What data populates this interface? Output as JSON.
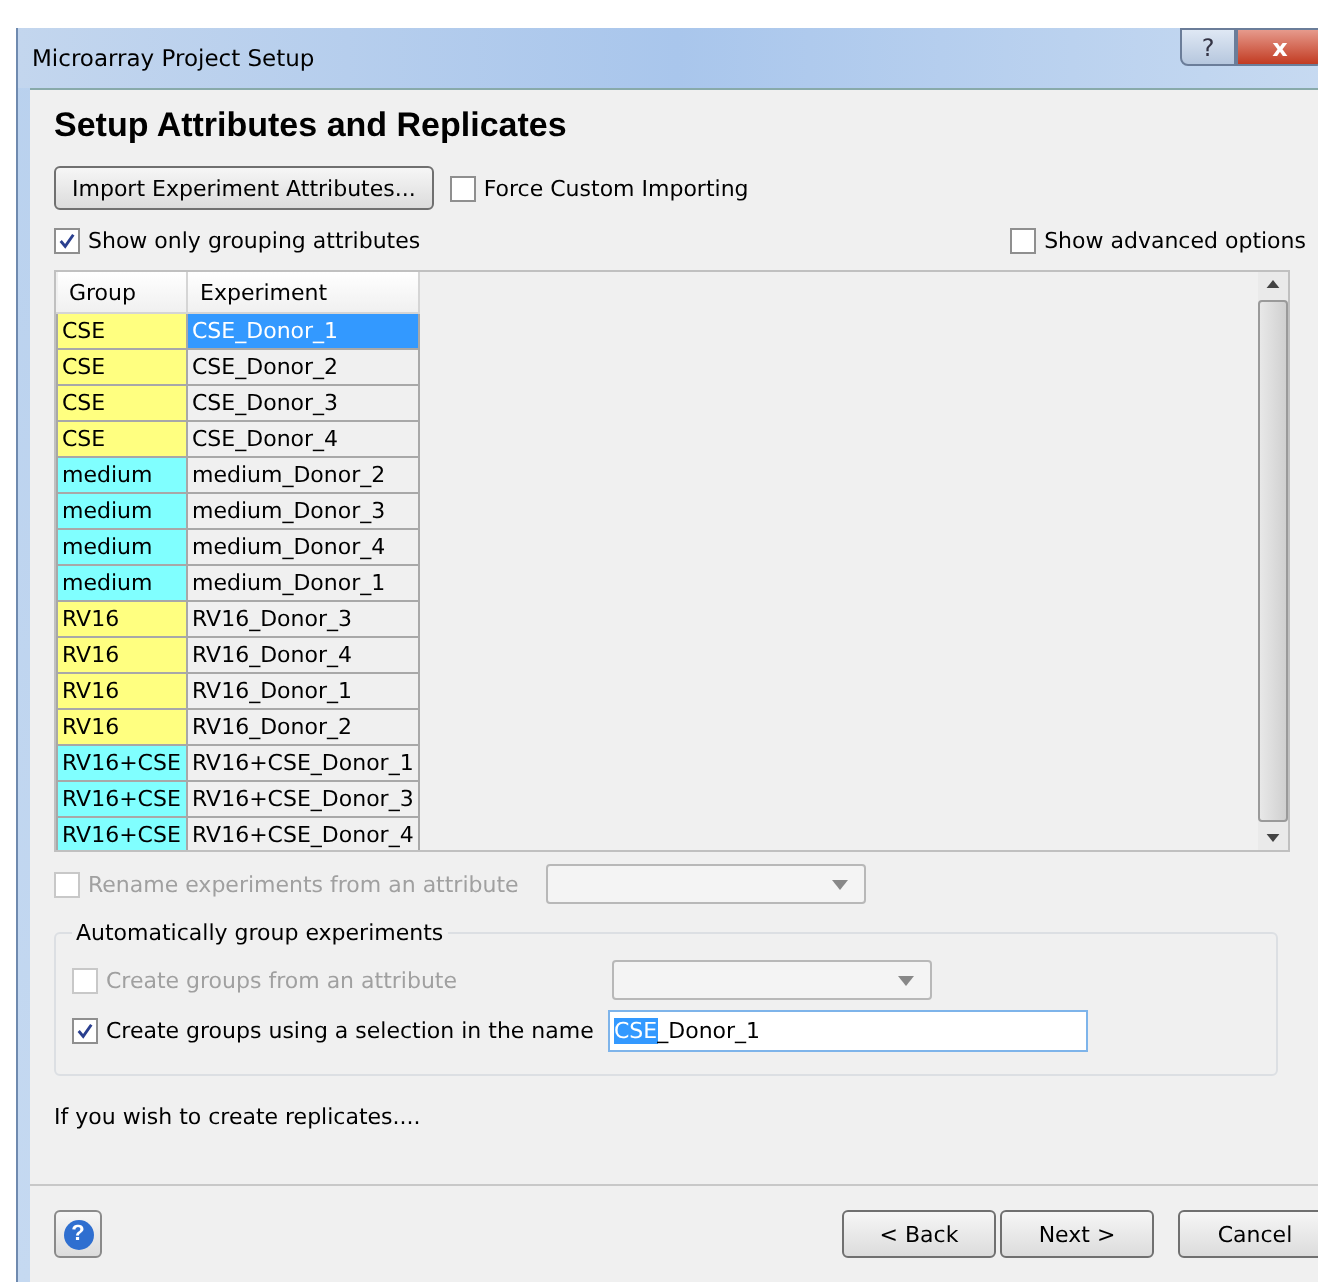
{
  "window": {
    "title": "Microarray Project Setup",
    "buttons": [
      "?",
      "x"
    ]
  },
  "heading": "Setup Attributes and Replicates",
  "import_button": "Import Experiment Attributes...",
  "force_custom_importing": {
    "label": "Force Custom Importing",
    "checked": false
  },
  "show_only_grouping": {
    "label": "Show only grouping attributes",
    "checked": true
  },
  "show_advanced": {
    "label": "Show advanced options",
    "checked": false
  },
  "table": {
    "columns": [
      "Group",
      "Experiment"
    ],
    "rows": [
      {
        "group": "CSE",
        "experiment": "CSE_Donor_1",
        "color": "#ffff80",
        "selected": true
      },
      {
        "group": "CSE",
        "experiment": "CSE_Donor_2",
        "color": "#ffff80",
        "selected": false
      },
      {
        "group": "CSE",
        "experiment": "CSE_Donor_3",
        "color": "#ffff80",
        "selected": false
      },
      {
        "group": "CSE",
        "experiment": "CSE_Donor_4",
        "color": "#ffff80",
        "selected": false
      },
      {
        "group": "medium",
        "experiment": "medium_Donor_2",
        "color": "#80ffff",
        "selected": false
      },
      {
        "group": "medium",
        "experiment": "medium_Donor_3",
        "color": "#80ffff",
        "selected": false
      },
      {
        "group": "medium",
        "experiment": "medium_Donor_4",
        "color": "#80ffff",
        "selected": false
      },
      {
        "group": "medium",
        "experiment": "medium_Donor_1",
        "color": "#80ffff",
        "selected": false
      },
      {
        "group": "RV16",
        "experiment": "RV16_Donor_3",
        "color": "#ffff80",
        "selected": false
      },
      {
        "group": "RV16",
        "experiment": "RV16_Donor_4",
        "color": "#ffff80",
        "selected": false
      },
      {
        "group": "RV16",
        "experiment": "RV16_Donor_1",
        "color": "#ffff80",
        "selected": false
      },
      {
        "group": "RV16",
        "experiment": "RV16_Donor_2",
        "color": "#ffff80",
        "selected": false
      },
      {
        "group": "RV16+CSE",
        "experiment": "RV16+CSE_Donor_1",
        "color": "#80ffff",
        "selected": false
      },
      {
        "group": "RV16+CSE",
        "experiment": "RV16+CSE_Donor_3",
        "color": "#80ffff",
        "selected": false
      },
      {
        "group": "RV16+CSE",
        "experiment": "RV16+CSE_Donor_4",
        "color": "#80ffff",
        "selected": false
      }
    ]
  },
  "rename": {
    "label": "Rename experiments from an attribute",
    "checked": false,
    "disabled": true
  },
  "group_box": {
    "title": "Automatically group experiments",
    "from_attribute": {
      "label": "Create groups from an attribute",
      "checked": false,
      "disabled": true
    },
    "using_selection": {
      "label": "Create groups using a selection in the name",
      "checked": true,
      "disabled": false
    },
    "name_field": {
      "selected_part": "CSE",
      "rest": "_Donor_1"
    }
  },
  "replicates_text": "If you wish to create replicates....",
  "help_button": "?",
  "buttons": [
    {
      "label": "< Back"
    },
    {
      "label": "Next >"
    },
    {
      "label": "Cancel"
    }
  ]
}
